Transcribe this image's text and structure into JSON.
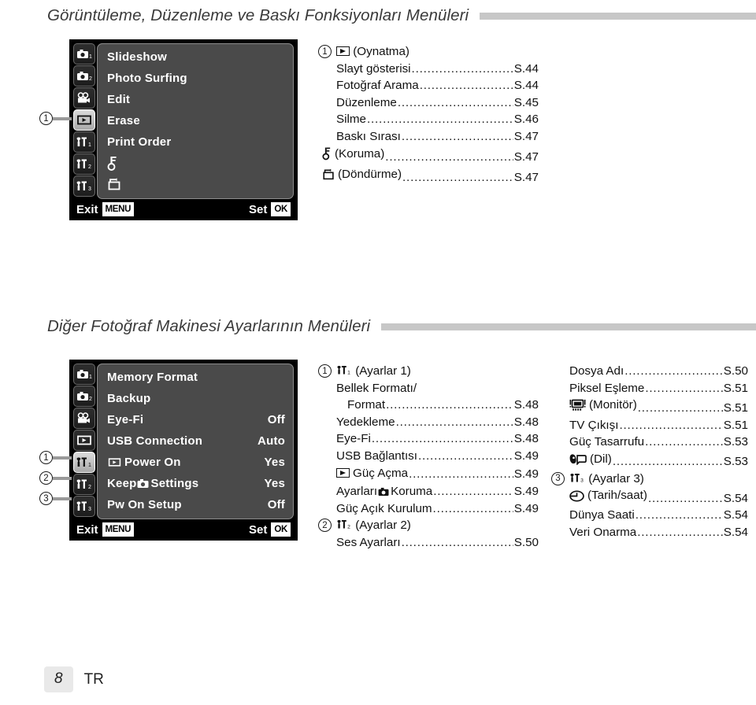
{
  "sections": [
    {
      "title": "Görüntüleme, Düzenleme ve Baskı Fonksiyonları Menüleri",
      "lcd": {
        "tabs": [
          {
            "icon": "camera1-icon",
            "selected": false
          },
          {
            "icon": "camera2-icon",
            "selected": false
          },
          {
            "icon": "movie-icon",
            "selected": false
          },
          {
            "icon": "playback-icon",
            "selected": true
          },
          {
            "icon": "wrench1-icon",
            "selected": false
          },
          {
            "icon": "wrench2-icon",
            "selected": false
          },
          {
            "icon": "wrench3-icon",
            "selected": false
          }
        ],
        "rows": [
          {
            "label": "Slideshow",
            "value": "",
            "icon": ""
          },
          {
            "label": "Photo Surfing",
            "value": "",
            "icon": ""
          },
          {
            "label": "Edit",
            "value": "",
            "icon": ""
          },
          {
            "label": "Erase",
            "value": "",
            "icon": ""
          },
          {
            "label": "Print Order",
            "value": "",
            "icon": ""
          },
          {
            "label": "",
            "value": "",
            "icon": "key-icon"
          },
          {
            "label": "",
            "value": "",
            "icon": "rotate-icon"
          }
        ],
        "exit_label": "Exit",
        "exit_badge": "MENU",
        "set_label": "Set",
        "set_badge": "OK"
      },
      "callouts": [
        {
          "number": "1",
          "target_row": 4
        }
      ],
      "toc": [
        {
          "number": "1",
          "group_icon": "playback-icon",
          "group_label": "(Oynatma)",
          "entries": [
            {
              "name": "Slayt gösterisi",
              "page": "S.44",
              "icon": "",
              "indent": 0
            },
            {
              "name": "Fotoğraf Arama",
              "page": "S.44",
              "icon": "",
              "indent": 0
            },
            {
              "name": "Düzenleme",
              "page": "S.45",
              "icon": "",
              "indent": 0
            },
            {
              "name": "Silme",
              "page": "S.46",
              "icon": "",
              "indent": 0
            },
            {
              "name": "Baskı Sırası",
              "page": "S.47",
              "icon": "",
              "indent": 0
            },
            {
              "name": "(Koruma)",
              "page": "S.47",
              "icon": "key-icon",
              "indent": 0
            },
            {
              "name": "(Döndürme)",
              "page": "S.47",
              "icon": "rotate-icon",
              "indent": 0
            }
          ]
        }
      ]
    },
    {
      "title": "Diğer Fotoğraf Makinesi Ayarlarının Menüleri",
      "lcd": {
        "tabs": [
          {
            "icon": "camera1-icon",
            "selected": false
          },
          {
            "icon": "camera2-icon",
            "selected": false
          },
          {
            "icon": "movie-icon",
            "selected": false
          },
          {
            "icon": "playback-icon",
            "selected": false
          },
          {
            "icon": "wrench1-icon",
            "selected": true
          },
          {
            "icon": "wrench2-icon",
            "selected": false
          },
          {
            "icon": "wrench3-icon",
            "selected": false
          }
        ],
        "rows": [
          {
            "label": "Memory Format",
            "value": "",
            "icon": ""
          },
          {
            "label": "Backup",
            "value": "",
            "icon": ""
          },
          {
            "label": "Eye-Fi",
            "value": "Off",
            "icon": ""
          },
          {
            "label": "USB Connection",
            "value": "Auto",
            "icon": ""
          },
          {
            "label": "Power On",
            "value": "Yes",
            "icon": "playback-icon"
          },
          {
            "label": "Keep|Settings",
            "value": "Yes",
            "icon": "camera-inline-icon"
          },
          {
            "label": "Pw On Setup",
            "value": "Off",
            "icon": ""
          }
        ],
        "exit_label": "Exit",
        "exit_badge": "MENU",
        "set_label": "Set",
        "set_badge": "OK"
      },
      "callouts": [
        {
          "number": "1",
          "target_row": 5
        },
        {
          "number": "2",
          "target_row": 6
        },
        {
          "number": "3",
          "target_row": 7
        }
      ],
      "toc": [
        {
          "number": "1",
          "group_icon": "wrench1-icon",
          "group_label": "(Ayarlar 1)",
          "entries": [
            {
              "name": "Bellek Formatı/",
              "page": "",
              "icon": "",
              "indent": 0,
              "nodots": true
            },
            {
              "name": "Format",
              "page": "S.48",
              "icon": "",
              "indent": 1
            },
            {
              "name": "Yedekleme",
              "page": "S.48",
              "icon": "",
              "indent": 0
            },
            {
              "name": "Eye-Fi",
              "page": "S.48",
              "icon": "",
              "indent": 0
            },
            {
              "name": "USB Bağlantısı",
              "page": "S.49",
              "icon": "",
              "indent": 0
            },
            {
              "name": "Güç Açma",
              "page": "S.49",
              "icon": "playback-icon",
              "indent": 0
            },
            {
              "name": "Ayarları|Koruma",
              "page": "S.49",
              "icon": "camera-inline-icon",
              "indent": 0
            },
            {
              "name": "Güç Açık Kurulum",
              "page": "S.49",
              "icon": "",
              "indent": 0
            }
          ]
        },
        {
          "number": "2",
          "group_icon": "wrench2-icon",
          "group_label": "(Ayarlar 2)",
          "entries": [
            {
              "name": "Ses Ayarları",
              "page": "S.50",
              "icon": "",
              "indent": 0
            },
            {
              "name": "Dosya Adı",
              "page": "S.50",
              "icon": "",
              "indent": 0
            },
            {
              "name": "Piksel Eşleme",
              "page": "S.51",
              "icon": "",
              "indent": 0
            },
            {
              "name": "(Monitör)",
              "page": "S.51",
              "icon": "monitor-icon",
              "indent": 0
            },
            {
              "name": "TV Çıkışı",
              "page": "S.51",
              "icon": "",
              "indent": 0
            },
            {
              "name": "Güç Tasarrufu",
              "page": "S.53",
              "icon": "",
              "indent": 0
            },
            {
              "name": "(Dil)",
              "page": "S.53",
              "icon": "language-icon",
              "indent": 0
            }
          ]
        },
        {
          "number": "3",
          "group_icon": "wrench3-icon",
          "group_label": "(Ayarlar 3)",
          "entries": [
            {
              "name": "(Tarih/saat)",
              "page": "S.54",
              "icon": "clock-icon",
              "indent": 0
            },
            {
              "name": "Dünya Saati",
              "page": "S.54",
              "icon": "",
              "indent": 0
            },
            {
              "name": "Veri Onarma",
              "page": "S.54",
              "icon": "",
              "indent": 0
            }
          ]
        }
      ]
    }
  ],
  "footer": {
    "page_number": "8",
    "language_code": "TR"
  },
  "colors": {
    "rule": "#c7c7c7",
    "lcd_panel": "#4a4a4a",
    "lcd_bg": "#000000",
    "page_badge": "#e9e9e9"
  }
}
